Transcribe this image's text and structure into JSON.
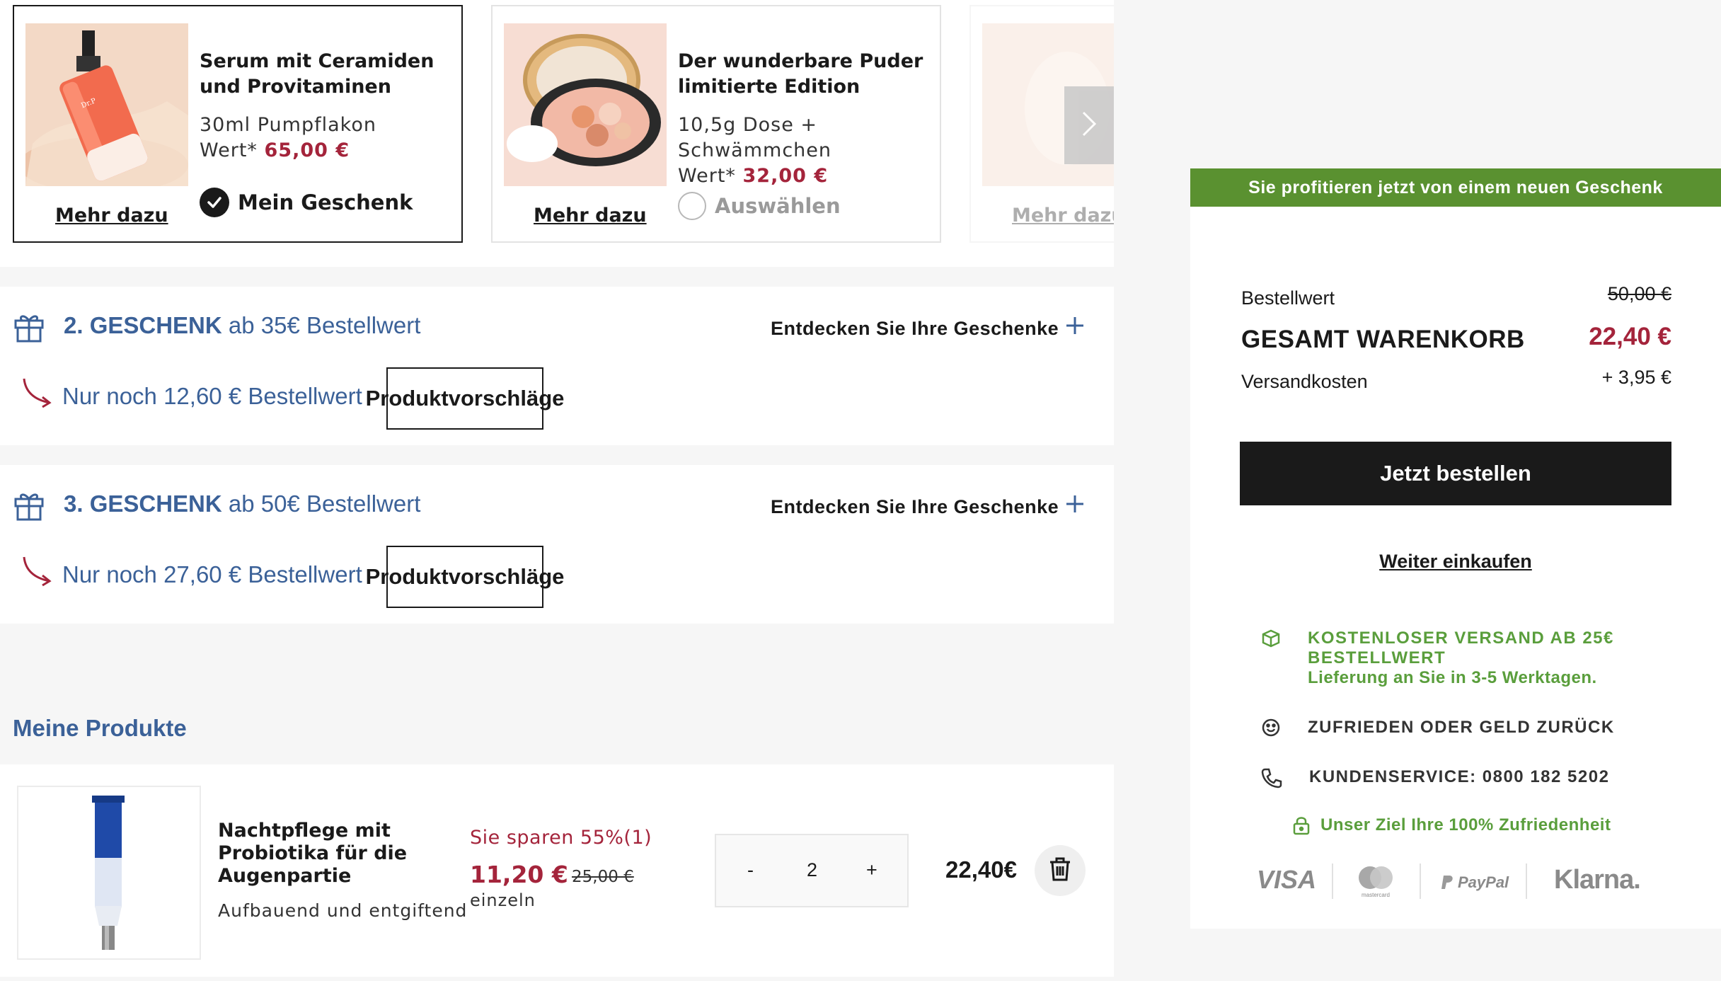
{
  "gifts": [
    {
      "title": "Serum mit Ceramiden und Provitaminen",
      "desc": "30ml Pumpflakon",
      "value_label": "Wert*",
      "value": "65,00 €",
      "more": "Mehr dazu",
      "choice_label": "Mein Geschenk",
      "selected": true
    },
    {
      "title": "Der wunderbare Puder limitierte Edition",
      "desc": "10,5g Dose + Schwämmchen",
      "value_label": "Wert*",
      "value": "32,00 €",
      "more": "Mehr dazu",
      "choice_label": "Auswählen",
      "selected": false
    },
    {
      "more": "Mehr dazu"
    }
  ],
  "tiers": [
    {
      "number": "2. GESCHENK",
      "threshold": "ab 35€ Bestellwert",
      "discover": "Entdecken Sie Ihre Geschenke",
      "remaining": "Nur noch 12,60 € Bestellwert",
      "suggest": "Produktvorschläge"
    },
    {
      "number": "3. GESCHENK",
      "threshold": "ab 50€ Bestellwert",
      "discover": "Entdecken Sie Ihre Geschenke",
      "remaining": "Nur noch 27,60 € Bestellwert",
      "suggest": "Produktvorschläge"
    }
  ],
  "my_products": {
    "heading": "Meine Produkte",
    "items": [
      {
        "name": "Nachtpflege mit Probiotika für die Augenpartie",
        "desc": "Aufbauend und entgiftend",
        "save": "Sie sparen 55%(1)",
        "price": "11,20 €",
        "old_price": "25,00 €",
        "unit": "einzeln",
        "qty_minus": "-",
        "qty": "2",
        "qty_plus": "+",
        "total": "22,40€"
      }
    ]
  },
  "summary": {
    "banner": "Sie profitieren jetzt von einem neuen Geschenk",
    "order_value_label": "Bestellwert",
    "order_value": "50,00 €",
    "total_label": "GESAMT WARENKORB",
    "total_value": "22,40 €",
    "shipping_label": "Versandkosten",
    "shipping_value": "+ 3,95 €",
    "order_button": "Jetzt bestellen",
    "continue": "Weiter einkaufen",
    "free_shipping": "KOSTENLOSER VERSAND AB 25€ BESTELLWERT",
    "delivery": "Lieferung an Sie in 3-5 Werktagen.",
    "satisfied": "ZUFRIEDEN ODER GELD ZURÜCK",
    "service": "KUNDENSERVICE: 0800 182 5202",
    "goal": "Unser Ziel Ihre 100% Zufriedenheit",
    "payments": [
      "VISA",
      "mastercard",
      "PayPal",
      "Klarna."
    ]
  },
  "colors": {
    "accent_blue": "#3b6198",
    "price_red": "#a4243b",
    "green": "#5a9130",
    "dark": "#1a1a1a"
  }
}
